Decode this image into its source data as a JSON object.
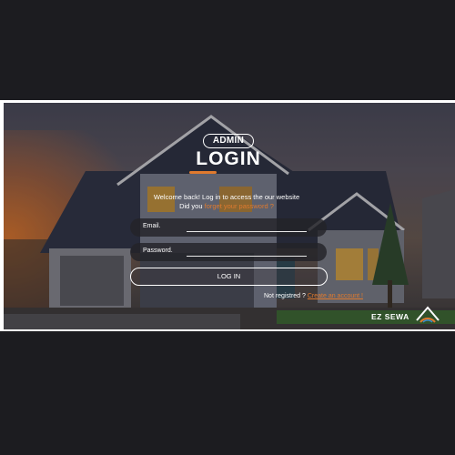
{
  "login": {
    "badge": "ADMIN",
    "title": "LOGIN",
    "welcome": "Welcome back! Log in to access the our website",
    "forgot_prefix": "Did you",
    "forgot_link": "forget your password ?",
    "email_label": "Email.",
    "password_label": "Password.",
    "login_button": "LOG IN",
    "register_prefix": "Not registred ?",
    "register_link": "Create an account !"
  },
  "brand": {
    "name": "EZ SEWA"
  },
  "colors": {
    "accent": "#e07a2e",
    "background": "#1c1c20",
    "field_bg": "#232328"
  },
  "icons": [
    "house-roof-logo-icon"
  ]
}
